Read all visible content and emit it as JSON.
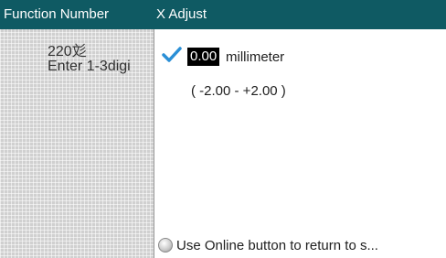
{
  "left_panel": {
    "header": "Function Number",
    "line1": "220彣",
    "line2": "Enter 1-3digi"
  },
  "right_panel": {
    "header": "X Adjust",
    "value": "0.00",
    "unit": "millimeter",
    "range": "( -2.00 - +2.00 )",
    "hint": "Use Online button to return to s..."
  },
  "colors": {
    "header_bg": "#0f5a63",
    "check": "#2a8fd6"
  },
  "icons": {
    "check": "check-icon",
    "hint": "info-circle-icon"
  }
}
